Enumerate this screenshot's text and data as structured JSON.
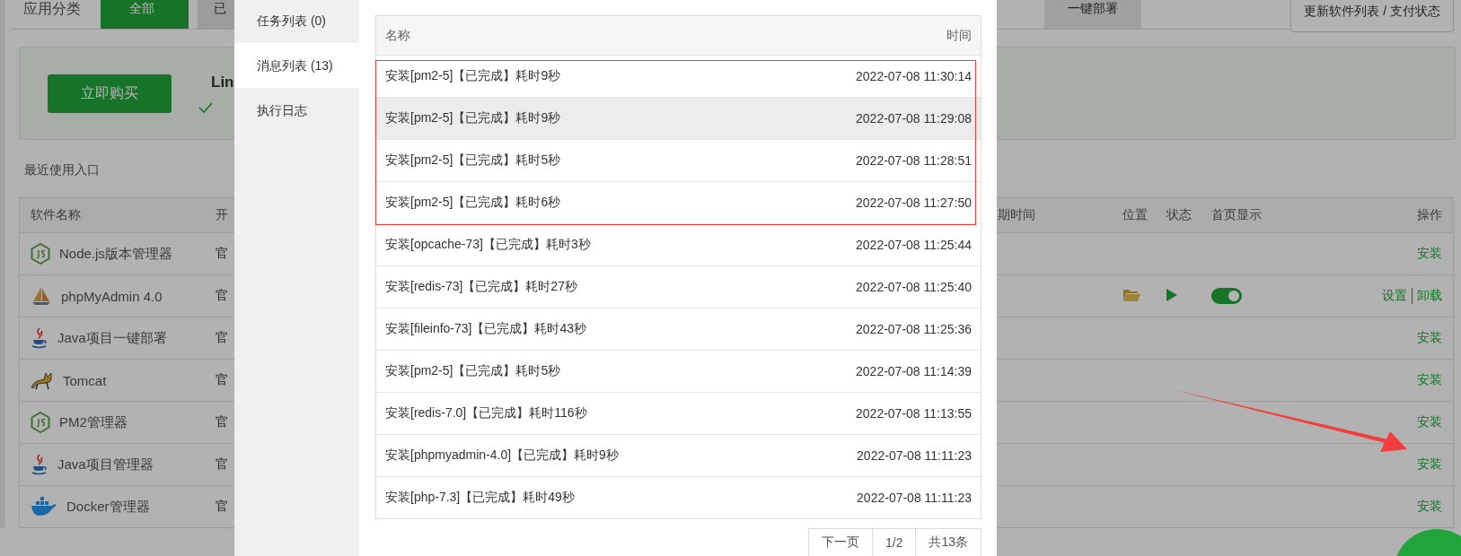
{
  "background": {
    "category_label": "应用分类",
    "filters": [
      {
        "label": "全部",
        "selected": true
      },
      {
        "label": "已",
        "selected": false
      }
    ],
    "deploy_button": "一键部署",
    "refresh_button": "更新软件列表 / 支付状态",
    "banner": {
      "buy_button": "立即购买",
      "title": "Lin"
    },
    "recent_label": "最近使用入口",
    "software_table": {
      "columns": [
        "软件名称",
        "开",
        "期时间",
        "位置",
        "状态",
        "首页显示",
        "操作"
      ],
      "rows": [
        {
          "name": "Node.js版本管理器",
          "developer": "官",
          "kind": "available",
          "actions": [
            "安装"
          ]
        },
        {
          "name": "phpMyAdmin 4.0",
          "developer": "官",
          "kind": "installed",
          "running": true,
          "home_display_on": true,
          "actions": [
            "设置",
            "卸载"
          ]
        },
        {
          "name": "Java项目一键部署",
          "developer": "官",
          "kind": "available",
          "actions": [
            "安装"
          ]
        },
        {
          "name": "Tomcat",
          "developer": "官",
          "kind": "available",
          "actions": [
            "安装"
          ]
        },
        {
          "name": "PM2管理器",
          "developer": "官",
          "kind": "available",
          "actions": [
            "安装"
          ]
        },
        {
          "name": "Java项目管理器",
          "developer": "官",
          "kind": "available",
          "actions": [
            "安装"
          ]
        },
        {
          "name": "Docker管理器",
          "developer": "官",
          "kind": "available",
          "actions": [
            "安装"
          ]
        }
      ]
    }
  },
  "dialog": {
    "tabs": [
      {
        "label": "任务列表 (0)",
        "selected": false
      },
      {
        "label": "消息列表 (13)",
        "selected": true
      },
      {
        "label": "执行日志",
        "selected": false
      }
    ],
    "table": {
      "columns": [
        "名称",
        "时间"
      ],
      "rows": [
        {
          "name": "安装[pm2-5]【已完成】耗时9秒",
          "time": "2022-07-08 11:30:14",
          "hovered": false
        },
        {
          "name": "安装[pm2-5]【已完成】耗时9秒",
          "time": "2022-07-08 11:29:08",
          "hovered": true
        },
        {
          "name": "安装[pm2-5]【已完成】耗时5秒",
          "time": "2022-07-08 11:28:51",
          "hovered": false
        },
        {
          "name": "安装[pm2-5]【已完成】耗时6秒",
          "time": "2022-07-08 11:27:50",
          "hovered": false
        },
        {
          "name": "安装[opcache-73]【已完成】耗时3秒",
          "time": "2022-07-08 11:25:44",
          "hovered": false
        },
        {
          "name": "安装[redis-73]【已完成】耗时27秒",
          "time": "2022-07-08 11:25:40",
          "hovered": false
        },
        {
          "name": "安装[fileinfo-73]【已完成】耗时43秒",
          "time": "2022-07-08 11:25:36",
          "hovered": false
        },
        {
          "name": "安装[pm2-5]【已完成】耗时5秒",
          "time": "2022-07-08 11:14:39",
          "hovered": false
        },
        {
          "name": "安装[redis-7.0]【已完成】耗时116秒",
          "time": "2022-07-08 11:13:55",
          "hovered": false
        },
        {
          "name": "安装[phpmyadmin-4.0]【已完成】耗时9秒",
          "time": "2022-07-08 11:11:23",
          "hovered": false
        },
        {
          "name": "安装[php-7.3]【已完成】耗时49秒",
          "time": "2022-07-08 11:11:23",
          "hovered": false
        }
      ]
    },
    "pagination": [
      "下一页",
      "1/2",
      "共13条"
    ]
  }
}
